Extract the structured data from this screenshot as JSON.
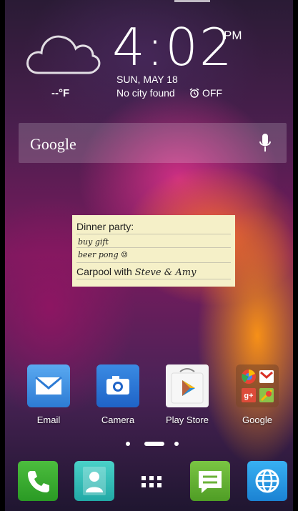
{
  "clock": {
    "time": "4:02",
    "ampm": "PM",
    "date": "SUN, MAY 18",
    "city": "No city found",
    "alarm": "OFF"
  },
  "weather": {
    "temp": "--°F",
    "icon": "cloud-icon"
  },
  "search": {
    "label": "Google",
    "icon": "mic-icon"
  },
  "note": {
    "title": "Dinner party:",
    "line2": "buy gift",
    "line3": "beer pong ☺",
    "line4_prefix": "Carpool with ",
    "line4_hand": "Steve & Amy"
  },
  "apps": [
    {
      "label": "Email",
      "icon": "email-icon"
    },
    {
      "label": "Camera",
      "icon": "camera-icon"
    },
    {
      "label": "Play Store",
      "icon": "play-store-icon"
    },
    {
      "label": "Google",
      "icon": "google-folder-icon"
    }
  ],
  "dock": [
    {
      "icon": "phone-icon"
    },
    {
      "icon": "contacts-icon"
    },
    {
      "icon": "app-drawer-icon"
    },
    {
      "icon": "messaging-icon"
    },
    {
      "icon": "browser-icon"
    }
  ],
  "colors": {
    "note_bg": "#f5f0c8",
    "search_bg": "rgba(255,255,255,0.18)"
  }
}
